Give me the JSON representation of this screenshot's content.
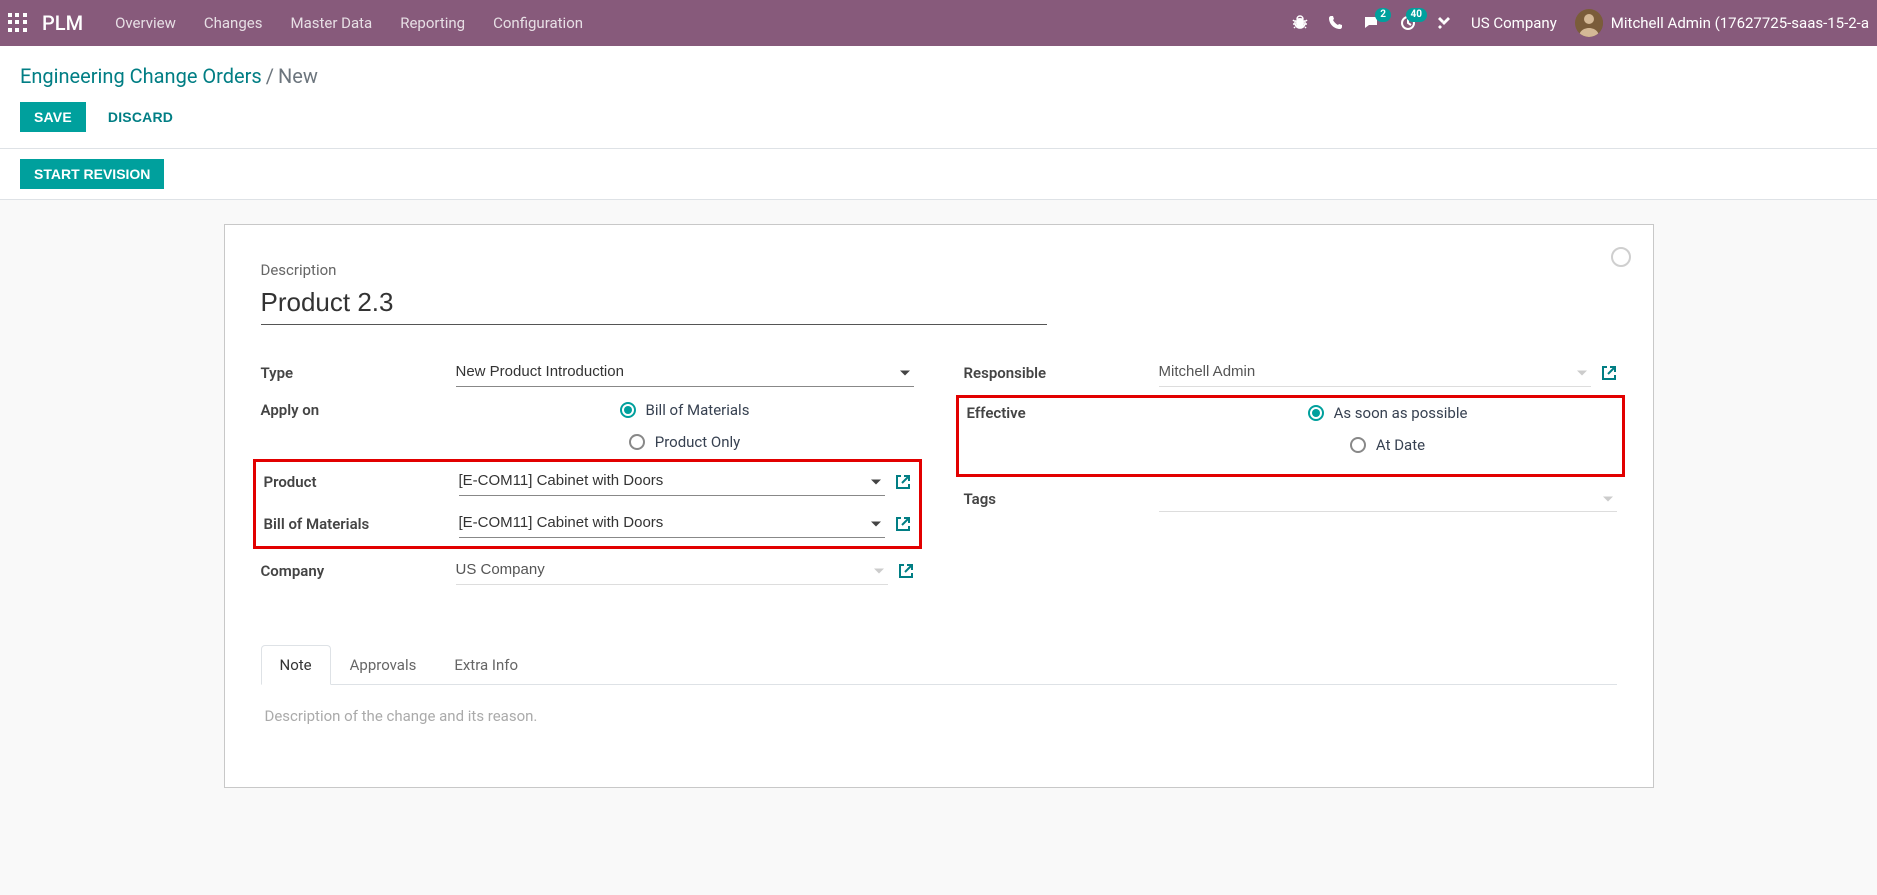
{
  "navbar": {
    "brand": "PLM",
    "menu": [
      "Overview",
      "Changes",
      "Master Data",
      "Reporting",
      "Configuration"
    ],
    "msg_badge": "2",
    "activity_badge": "40",
    "company": "US Company",
    "user_name": "Mitchell Admin (17627725-saas-15-2-a"
  },
  "breadcrumb": {
    "parent": "Engineering Change Orders",
    "current": "New"
  },
  "buttons": {
    "save": "Save",
    "discard": "Discard",
    "start_revision": "Start Revision"
  },
  "form": {
    "desc_label": "Description",
    "desc_value": "Product 2.3",
    "type_label": "Type",
    "type_value": "New Product Introduction",
    "apply_on_label": "Apply on",
    "apply_on_bom": "Bill of Materials",
    "apply_on_product": "Product Only",
    "product_label": "Product",
    "product_value": "[E-COM11] Cabinet with Doors",
    "bom_label": "Bill of Materials",
    "bom_value": "[E-COM11] Cabinet with Doors",
    "company_label": "Company",
    "company_value": "US Company",
    "responsible_label": "Responsible",
    "responsible_value": "Mitchell Admin",
    "effective_label": "Effective",
    "effective_asap": "As soon as possible",
    "effective_atdate": "At Date",
    "tags_label": "Tags"
  },
  "tabs": {
    "note": "Note",
    "approvals": "Approvals",
    "extra": "Extra Info"
  },
  "note_placeholder": "Description of the change and its reason."
}
